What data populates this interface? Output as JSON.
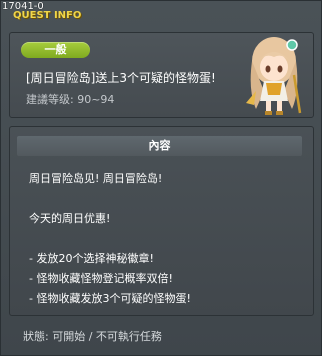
{
  "header": {
    "quest_id": "17041-0",
    "title": "QUEST INFO"
  },
  "quest": {
    "category_badge": "一般",
    "name": "[周日冒险岛]送上3个可疑的怪物蛋!",
    "level_requirement": "建議等级: 90~94"
  },
  "content": {
    "header_label": "內容",
    "lines": [
      "周日冒险岛见! 周日冒险岛!",
      "",
      "今天的周日优惠!",
      "",
      "- 发放20个选择神秘徽章!",
      "- 怪物收藏怪物登记概率双倍!",
      "- 怪物收藏发放3个可疑的怪物蛋!"
    ]
  },
  "footer": {
    "status": "狀態: 可開始 / 不可執行任務"
  },
  "colors": {
    "badge": "#8cb82a",
    "title": "#f0d64a",
    "panel_bg": "#454b50"
  },
  "icons": {
    "npc_portrait": "npc-girl-portrait-icon"
  }
}
